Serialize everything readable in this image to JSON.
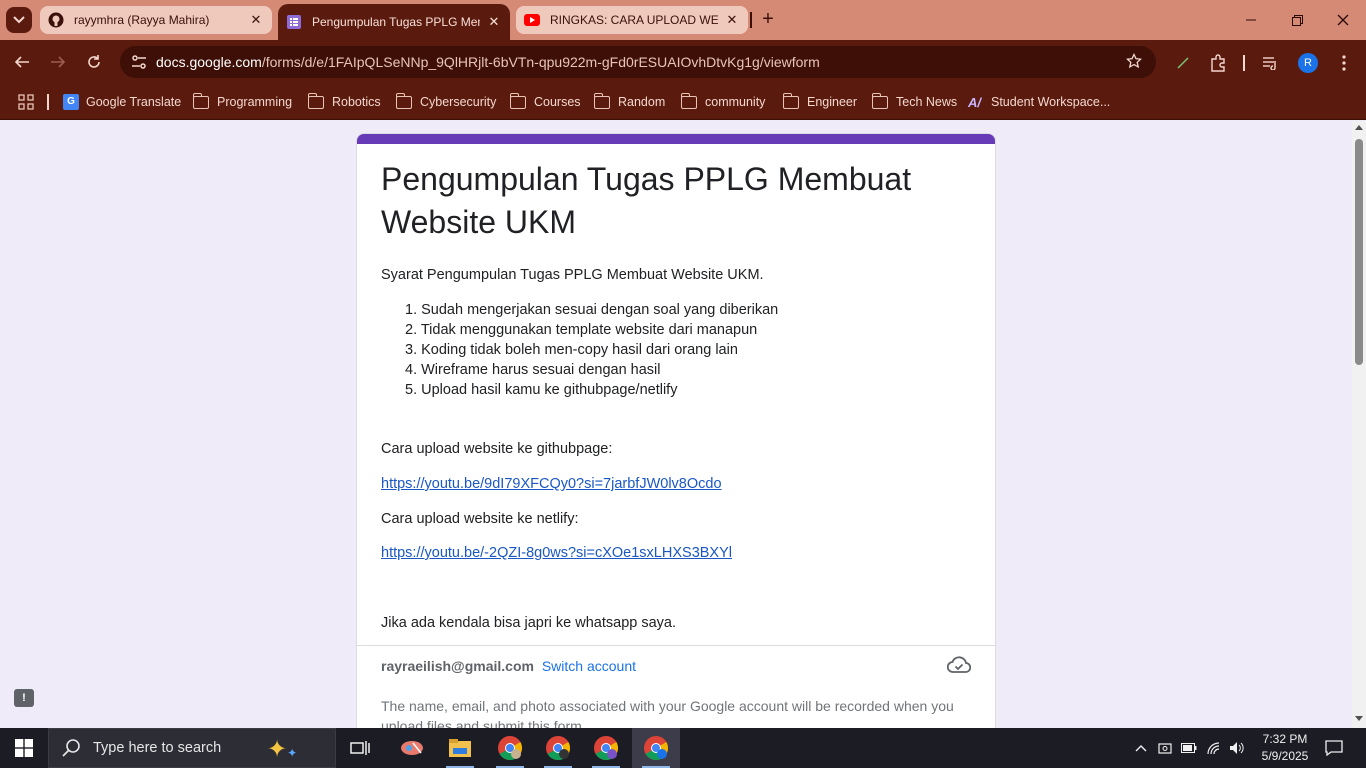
{
  "browser": {
    "tabs": [
      {
        "title": "rayymhra (Rayya Mahira)",
        "icon": "github-icon",
        "active": false
      },
      {
        "title": "Pengumpulan Tugas PPLG Membuat Website UKM",
        "icon": "google-forms-icon",
        "active": true
      },
      {
        "title": "RINGKAS: CARA UPLOAD WEBSITE",
        "icon": "youtube-icon",
        "active": false
      }
    ],
    "new_tab": "+",
    "url_host": "docs.google.com",
    "url_path": "/forms/d/e/1FAIpQLSeNNp_9QlHRjlt-6bVTn-qpu922m-gFd0rESUAIOvhDtvKg1g/viewform",
    "profile_initial": "R",
    "bookmarks": [
      {
        "label": "Google Translate",
        "icon": "google-translate-icon"
      },
      {
        "label": "Programming",
        "icon": "folder-icon"
      },
      {
        "label": "Robotics",
        "icon": "folder-icon"
      },
      {
        "label": "Cybersecurity",
        "icon": "folder-icon"
      },
      {
        "label": "Courses",
        "icon": "folder-icon"
      },
      {
        "label": "Random",
        "icon": "folder-icon"
      },
      {
        "label": "community",
        "icon": "folder-icon"
      },
      {
        "label": "Engineer",
        "icon": "folder-icon"
      },
      {
        "label": "Tech News",
        "icon": "folder-icon"
      },
      {
        "label": "Student Workspace...",
        "icon": "student-workspace-icon"
      }
    ]
  },
  "form": {
    "accent_color": "#673ab7",
    "title": "Pengumpulan Tugas PPLG Membuat Website UKM",
    "description": "Syarat Pengumpulan Tugas PPLG Membuat Website UKM.",
    "requirements": [
      "1. Sudah mengerjakan sesuai dengan soal yang diberikan",
      "2. Tidak menggunakan template website dari manapun",
      "3. Koding tidak boleh men-copy hasil dari orang lain",
      "4. Wireframe harus sesuai dengan hasil",
      "5. Upload hasil kamu ke githubpage/netlify"
    ],
    "githubpage_label": "Cara upload website ke githubpage:",
    "githubpage_link": "https://youtu.be/9dI79XFCQy0?si=7jarbfJW0lv8Ocdo",
    "netlify_label": "Cara upload website ke netlify:",
    "netlify_link": "https://youtu.be/-2QZI-8g0ws?si=cXOe1sxLHXS3BXYl",
    "contact_note": "Jika ada kendala bisa japri ke whatsapp saya.",
    "account_email": "rayraeilish@gmail.com",
    "switch_account": "Switch account",
    "privacy_notice": "The name, email, and photo associated with your Google account will be recorded when you upload files and submit this form"
  },
  "taskbar": {
    "search_placeholder": "Type here to search",
    "time": "7:32 PM",
    "date": "5/9/2025"
  }
}
